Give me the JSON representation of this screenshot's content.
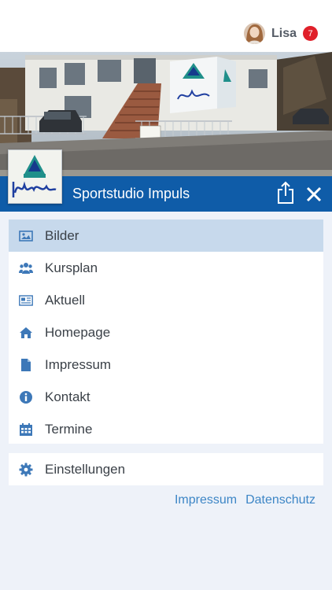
{
  "user": {
    "name": "Lisa",
    "notification_count": "7"
  },
  "studio": {
    "name": "Sportstudio Impuls"
  },
  "menu": {
    "items": [
      {
        "label": "Bilder",
        "icon": "image-icon",
        "active": true
      },
      {
        "label": "Kursplan",
        "icon": "users-icon",
        "active": false
      },
      {
        "label": "Aktuell",
        "icon": "newspaper-icon",
        "active": false
      },
      {
        "label": "Homepage",
        "icon": "home-icon",
        "active": false
      },
      {
        "label": "Impressum",
        "icon": "file-icon",
        "active": false
      },
      {
        "label": "Kontakt",
        "icon": "info-icon",
        "active": false
      },
      {
        "label": "Termine",
        "icon": "calendar-icon",
        "active": false
      }
    ]
  },
  "settings": {
    "label": "Einstellungen",
    "icon": "gear-icon"
  },
  "footer": {
    "links": [
      "Impressum",
      "Datenschutz"
    ]
  },
  "colors": {
    "brand": "#0f5ca8",
    "active_item": "#c7d9ec",
    "icon": "#3d78b8",
    "link": "#3d86c6",
    "badge": "#e0202a",
    "background": "#eef2f9"
  }
}
